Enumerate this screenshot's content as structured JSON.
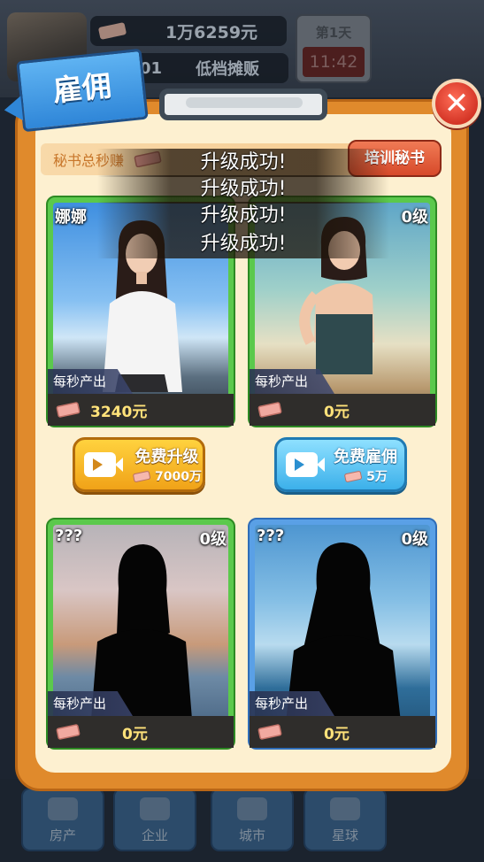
{
  "hud": {
    "money": "1万6259元",
    "shop_level": "01",
    "shop_name": "低档摊贩",
    "day": "第1天",
    "time": "11:42"
  },
  "dialog": {
    "title": "雇佣",
    "earn_label": "秘书总秒赚",
    "train_button": "培训秘书",
    "toasts": [
      "升级成功!",
      "升级成功!",
      "升级成功!",
      "升级成功!"
    ]
  },
  "cards": [
    {
      "name": "娜娜",
      "level": "",
      "rate_label": "每秒产出",
      "rate": "3240元"
    },
    {
      "name": "",
      "level": "0级",
      "rate_label": "每秒产出",
      "rate": "0元"
    },
    {
      "name": "???",
      "level": "0级",
      "rate_label": "每秒产出",
      "rate": "0元"
    },
    {
      "name": "???",
      "level": "0级",
      "rate_label": "每秒产出",
      "rate": "0元"
    }
  ],
  "actions": {
    "upgrade": {
      "label": "免费升级",
      "cost": "7000万"
    },
    "hire": {
      "label": "免费雇佣",
      "cost": "5万"
    }
  },
  "nav": [
    "房产",
    "企业",
    "城市",
    "星球"
  ],
  "colors": {
    "panel_orange": "#e08a2c",
    "panel_cream": "#fdf0d0",
    "card_green": "#5bc94c",
    "card_blue": "#5aa0e6",
    "rate_yellow": "#ffe27a"
  }
}
